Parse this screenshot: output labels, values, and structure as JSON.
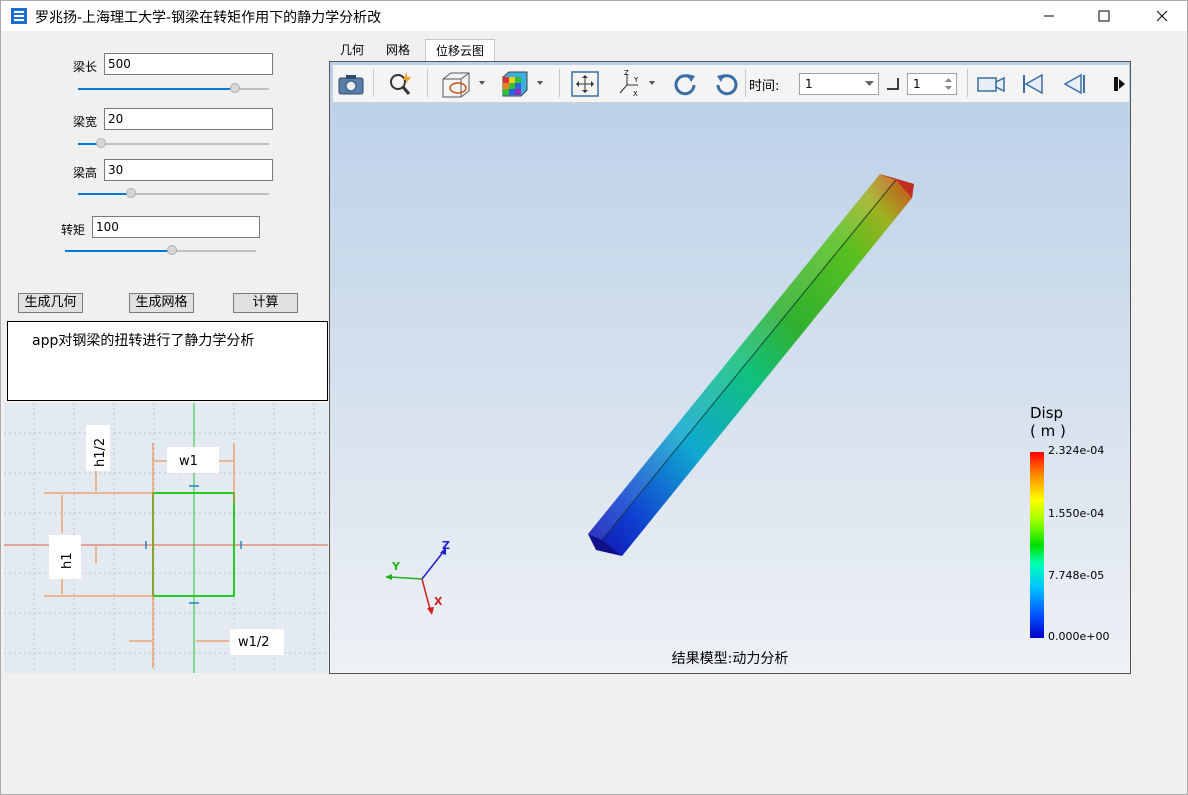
{
  "window": {
    "title": "罗兆扬-上海理工大学-钢梁在转矩作用下的静力学分析改",
    "icons": [
      "app-icon",
      "minimize-icon",
      "maximize-icon",
      "close-icon"
    ]
  },
  "params": {
    "length": {
      "label": "梁长",
      "value": "500",
      "slider_fraction": 0.82
    },
    "width": {
      "label": "梁宽",
      "value": "20",
      "slider_fraction": 0.12
    },
    "height": {
      "label": "梁高",
      "value": "30",
      "slider_fraction": 0.28
    },
    "torque": {
      "label": "转矩",
      "value": "100",
      "slider_fraction": 0.56
    }
  },
  "buttons": {
    "geometry": "生成几何",
    "mesh": "生成网格",
    "compute": "计算"
  },
  "info": {
    "text": "app对钢梁的扭转进行了静力学分析"
  },
  "diagram": {
    "labels": {
      "h_half": "h1/2",
      "w": "w1",
      "h": "h1",
      "w_half": "w1/2"
    }
  },
  "tabs": [
    {
      "label": "几何",
      "active": false
    },
    {
      "label": "网格",
      "active": false
    },
    {
      "label": "位移云图",
      "active": true
    }
  ],
  "toolbar": {
    "icons": [
      "camera-icon",
      "zoom-icon",
      "display-mode-icon",
      "color-cube-icon",
      "fit-view-icon",
      "axes-icon",
      "rotate-cw-icon",
      "rotate-ccw-icon",
      "video-camera-icon",
      "first-frame-icon",
      "prev-frame-icon",
      "next-frame-icon"
    ],
    "time_label": "时间:",
    "time_value": "1",
    "step_value": "1"
  },
  "viewer": {
    "axes": {
      "x": "X",
      "y": "Y",
      "z": "Z"
    },
    "legend": {
      "title": "Disp",
      "unit": "( m )",
      "values": [
        "2.324e-04",
        "1.550e-04",
        "7.748e-05",
        "0.000e+00"
      ]
    },
    "caption": "结果模型:动力分析"
  },
  "colors": {
    "accent": "#0078d7",
    "diagram_green": "#22cc22",
    "diagram_orange": "#f08030"
  }
}
